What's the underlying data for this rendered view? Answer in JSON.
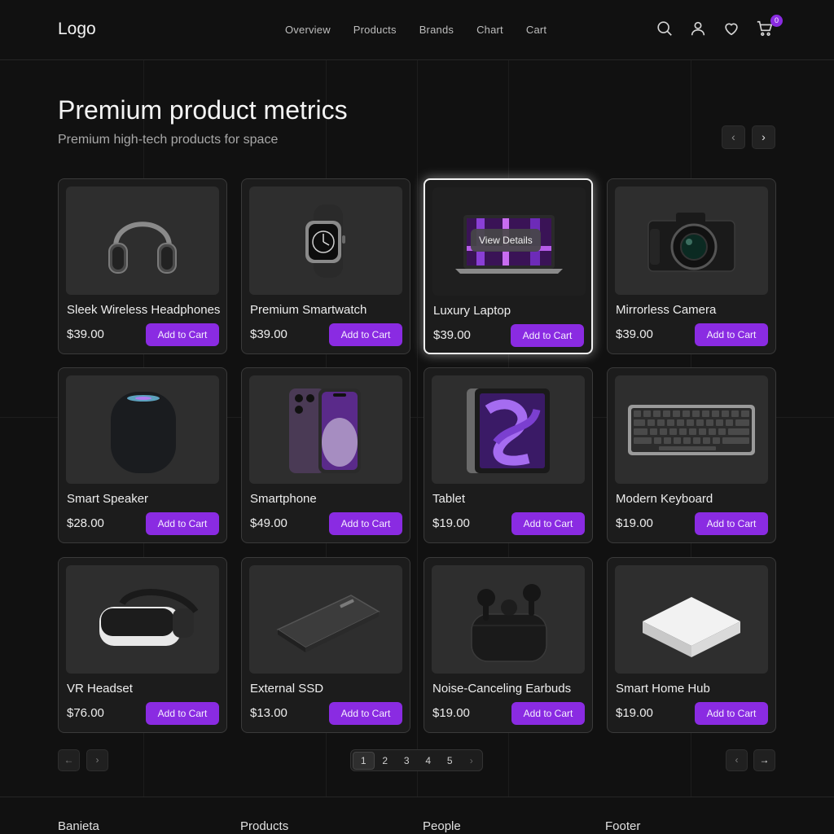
{
  "header": {
    "logo": "Logo",
    "nav": [
      "Overview",
      "Products",
      "Brands",
      "Chart",
      "Cart"
    ],
    "cart_count": "0",
    "icons": [
      "search-icon",
      "user-icon",
      "heart-icon",
      "cart-icon"
    ]
  },
  "hero": {
    "title": "Premium product metrics",
    "subtitle": "Premium high-tech products for space"
  },
  "products": [
    {
      "name": "Sleek Wireless Headphones",
      "price": "$39.00",
      "button": "Add to Cart",
      "icon": "headphones-icon"
    },
    {
      "name": "Premium Smartwatch",
      "price": "$39.00",
      "button": "Add to Cart",
      "icon": "smartwatch-icon"
    },
    {
      "name": "Luxury Laptop",
      "price": "$39.00",
      "button": "Add to Cart",
      "icon": "laptop-icon",
      "overlay": "View Details"
    },
    {
      "name": "Mirrorless Camera",
      "price": "$39.00",
      "button": "Add to Cart",
      "icon": "camera-icon"
    },
    {
      "name": "Smart Speaker",
      "price": "$28.00",
      "button": "Add to Cart",
      "icon": "speaker-icon"
    },
    {
      "name": "Smartphone",
      "price": "$49.00",
      "button": "Add to Cart",
      "icon": "smartphone-icon"
    },
    {
      "name": "Tablet",
      "price": "$19.00",
      "button": "Add to Cart",
      "icon": "tablet-icon"
    },
    {
      "name": "Modern Keyboard",
      "price": "$19.00",
      "button": "Add to Cart",
      "icon": "keyboard-icon"
    },
    {
      "name": "VR Headset",
      "price": "$76.00",
      "button": "Add to Cart",
      "icon": "vr-headset-icon"
    },
    {
      "name": "External SSD",
      "price": "$13.00",
      "button": "Add to Cart",
      "icon": "ssd-icon"
    },
    {
      "name": "Noise-Canceling Earbuds",
      "price": "$19.00",
      "button": "Add to Cart",
      "icon": "earbuds-icon"
    },
    {
      "name": "Smart Home Hub",
      "price": "$19.00",
      "button": "Add to Cart",
      "icon": "home-hub-icon"
    }
  ],
  "pagination": {
    "pages": [
      "1",
      "2",
      "3",
      "4",
      "5"
    ],
    "current": "1"
  },
  "footer": {
    "columns": [
      "Banieta",
      "Products",
      "People",
      "Footer"
    ]
  },
  "colors": {
    "accent": "#8a2be2",
    "background": "#111111",
    "card": "#1c1c1c"
  }
}
